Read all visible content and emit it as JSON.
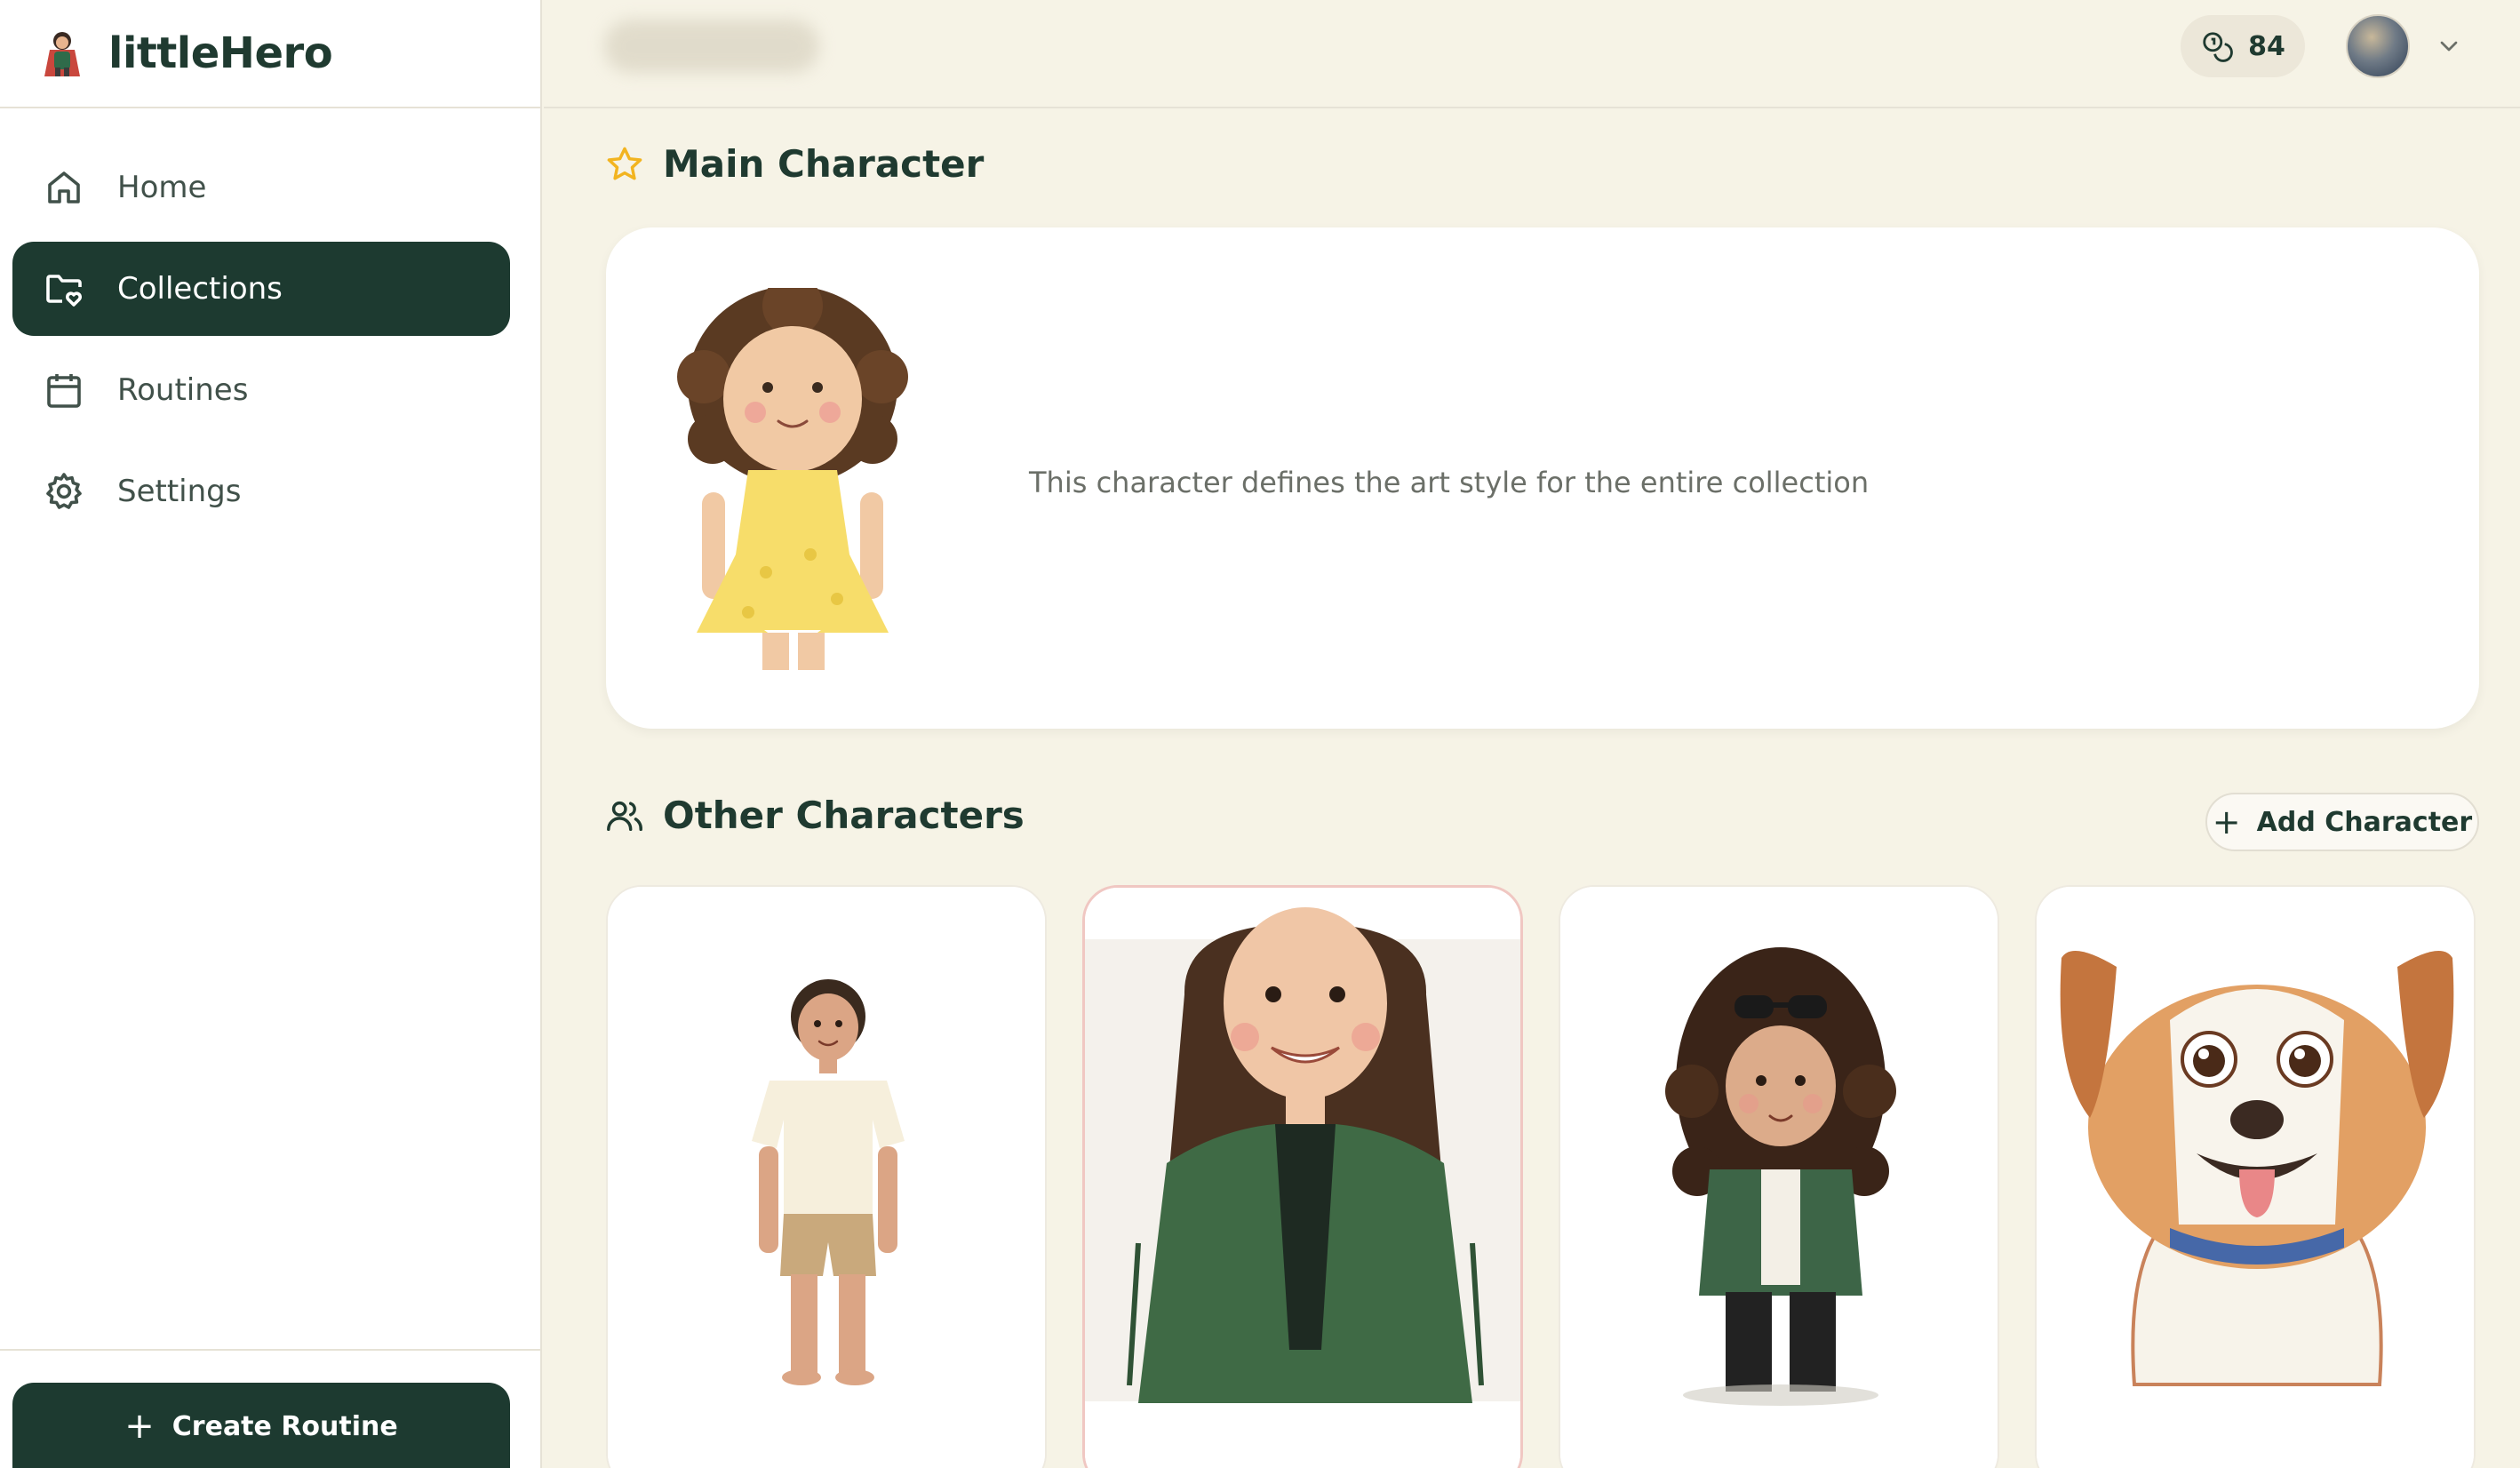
{
  "app": {
    "name": "littleHero"
  },
  "sidebar": {
    "items": [
      {
        "label": "Home",
        "icon": "home-icon",
        "active": false
      },
      {
        "label": "Collections",
        "icon": "folder-heart-icon",
        "active": true
      },
      {
        "label": "Routines",
        "icon": "calendar-icon",
        "active": false
      },
      {
        "label": "Settings",
        "icon": "gear-icon",
        "active": false
      }
    ],
    "create_label": "Create Routine"
  },
  "header": {
    "credits": "84",
    "credits_icon": "coins-icon"
  },
  "main_character": {
    "title": "Main Character",
    "description": "This character defines the art style for the entire collection"
  },
  "other_characters": {
    "title": "Other Characters",
    "add_label": "Add Character",
    "cards": [
      {
        "kind": "boy",
        "selected": false
      },
      {
        "kind": "woman",
        "selected": true
      },
      {
        "kind": "girl-sunglasses",
        "selected": false
      },
      {
        "kind": "dog",
        "selected": false
      }
    ]
  },
  "colors": {
    "accent": "#1d3a30",
    "background": "#f6f3e6",
    "star": "#f2b420",
    "selected_border": "#f0c7c2"
  }
}
